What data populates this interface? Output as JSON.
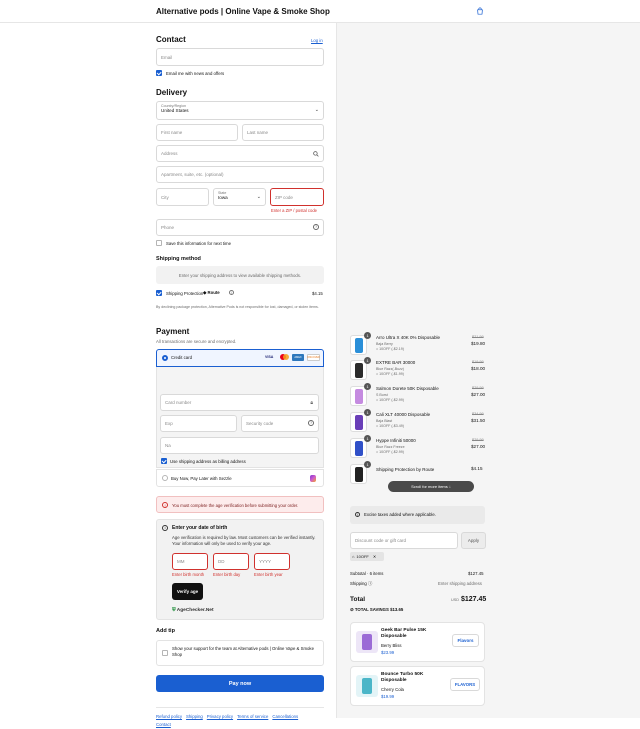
{
  "header": {
    "title": "Alternative pods | Online Vape & Smoke Shop",
    "bag_icon": "shopping-bag-icon"
  },
  "contact": {
    "heading": "Contact",
    "login": "Log in",
    "email_placeholder": "Email",
    "newsletter_label": "Email me with news and offers"
  },
  "delivery": {
    "heading": "Delivery",
    "country_label": "Country/Region",
    "country_value": "United States",
    "first_name": "First name",
    "last_name": "Last name",
    "address": "Address",
    "apartment": "Apartment, suite, etc. (optional)",
    "city": "City",
    "state_label": "State",
    "state_value": "Iowa",
    "zip": "ZIP code",
    "zip_error": "Enter a ZIP / postal code",
    "phone": "Phone",
    "save_info": "Save this information for next time"
  },
  "shipping": {
    "heading": "Shipping method",
    "placeholder": "Enter your shipping address to view available shipping methods.",
    "protection_label": "Shipping Protection",
    "route_label": "Route",
    "protection_price": "$4.15",
    "disclaimer": "By declining package protection, Alternative Pods is not responsible for lost, damaged, or stolen items."
  },
  "payment": {
    "heading": "Payment",
    "subtitle": "All transactions are secure and encrypted.",
    "credit_card": "Credit card",
    "card_brands": [
      "VISA",
      "MC",
      "AMEX",
      "DISCOVER"
    ],
    "card_number": "Card number",
    "expiry": "Exp",
    "security": "Security code",
    "name": "Na",
    "billing_same": "Use shipping address as billing address",
    "sezzle": "Buy Now, Pay Later with Sezzle"
  },
  "age": {
    "warning": "You must complete the age verification before submitting your order.",
    "heading": "Enter your date of birth",
    "desc": "Age verification is required by law. Most customers can be verified instantly. Your information will only be used to verify your age.",
    "mm": "MM",
    "dd": "DD",
    "yyyy": "YYYY",
    "err_month": "Enter birth month",
    "err_day": "Enter birth day",
    "err_year": "Enter birth year",
    "verify": "Verify age",
    "brand": "AgeChecker.Net"
  },
  "tip": {
    "heading": "Add tip",
    "label": "Show your support for the team at Alternative pods | Online Vape & Smoke Shop"
  },
  "pay_now": "Pay now",
  "footer_links": [
    "Refund policy",
    "Shipping",
    "Privacy policy",
    "Terms of service",
    "Cancellations",
    "Contact"
  ],
  "cart": {
    "items": [
      {
        "qty": "1",
        "name": "Arro Ultra X 40K 0% Disposable",
        "variant": "Baja Berry",
        "discount": "10OFF (-$2.19)",
        "old": "$21.99",
        "price": "$19.80",
        "color": "#2a8fd8"
      },
      {
        "qty": "1",
        "name": "EXTRE BAR 30000",
        "variant": "Blue Razz(-Buzz)",
        "discount": "10OFF (-$1.99)",
        "old": "$19.99",
        "price": "$18.00",
        "color": "#2b2b2b"
      },
      {
        "qty": "1",
        "name": "Salmon Dorete 50K Disposable",
        "variant": "S Burst",
        "discount": "10OFF (-$2.99)",
        "old": "$29.99",
        "price": "$27.00",
        "color": "#c58be0"
      },
      {
        "qty": "1",
        "name": "Cali XLT 40000 Disposable",
        "variant": "Baja Blast",
        "discount": "10OFF (-$3.49)",
        "old": "$34.99",
        "price": "$31.50",
        "color": "#6a3fb8"
      },
      {
        "qty": "1",
        "name": "Hyppe Infiniti 50000",
        "variant": "Blue Razz Freeze",
        "discount": "10OFF (-$2.99)",
        "old": "$29.99",
        "price": "$27.00",
        "color": "#3050c8"
      },
      {
        "qty": "1",
        "name": "Shipping Protection by Route",
        "variant": "",
        "discount": "",
        "old": "",
        "price": "$4.15",
        "color": "#222222"
      }
    ],
    "scroll_hint": "Scroll for more items",
    "taxes_note": "Excise taxes added where applicable.",
    "discount_placeholder": "Discount code or gift card",
    "apply": "Apply",
    "code_tag": "10OFF",
    "subtotal_label": "Subtotal · 6 items",
    "subtotal": "$127.45",
    "shipping_label": "Shipping",
    "shipping_value": "Enter shipping address",
    "total_label": "Total",
    "currency": "USD",
    "total": "$127.45",
    "savings_label": "TOTAL SAVINGS",
    "savings": "$13.65"
  },
  "upsell": [
    {
      "name": "Geek Bar Pulse 15K Disposable",
      "variant": "Berry Bliss",
      "price": "$23.99",
      "button": "Flavors",
      "color": "#9b6bd6"
    },
    {
      "name": "Bounce Turbo 50K Disposable",
      "variant": "Cherry Cola",
      "price": "$19.99",
      "button": "FLAVORS",
      "color": "#4bb6c8"
    }
  ]
}
